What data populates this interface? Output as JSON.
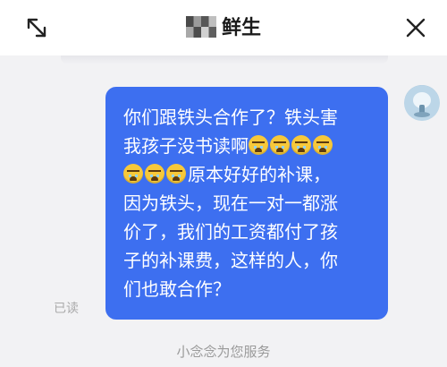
{
  "header": {
    "title": "鲜生",
    "expand_icon": "expand-arrows-icon",
    "close_icon": "close-icon"
  },
  "message": {
    "lines": [
      "你们跟铁头合作了？铁头害",
      "我孩子没书读啊",
      "原本好好的补课，",
      "因为铁头，现在一对一都涨",
      "价了，我们的工资都付了孩",
      "子的补课费，这样的人，你",
      "们也敢合作？"
    ],
    "emoji_name": "crying-face-emoji",
    "bubble_color": "#3d6ff0",
    "read_status": "已读"
  },
  "footer": {
    "service_text": "小念念为您服务"
  }
}
